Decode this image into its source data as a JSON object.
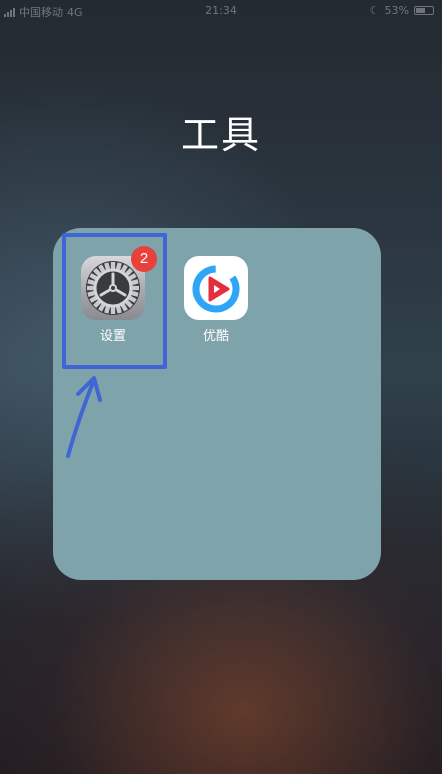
{
  "status_bar": {
    "carrier": "中国移动",
    "network": "4G",
    "time": "21:34",
    "battery": "53%"
  },
  "folder": {
    "title": "工具",
    "apps": [
      {
        "label": "设置",
        "icon": "gear-icon",
        "badge": "2"
      },
      {
        "label": "优酷",
        "icon": "youku-play-icon"
      }
    ]
  },
  "annotation": {
    "color": "#3f66d4"
  },
  "colors": {
    "folder_bg": "#7ea3ab",
    "badge": "#e8403b",
    "youku_blue": "#2ea6f5",
    "youku_red": "#e52d3c"
  }
}
